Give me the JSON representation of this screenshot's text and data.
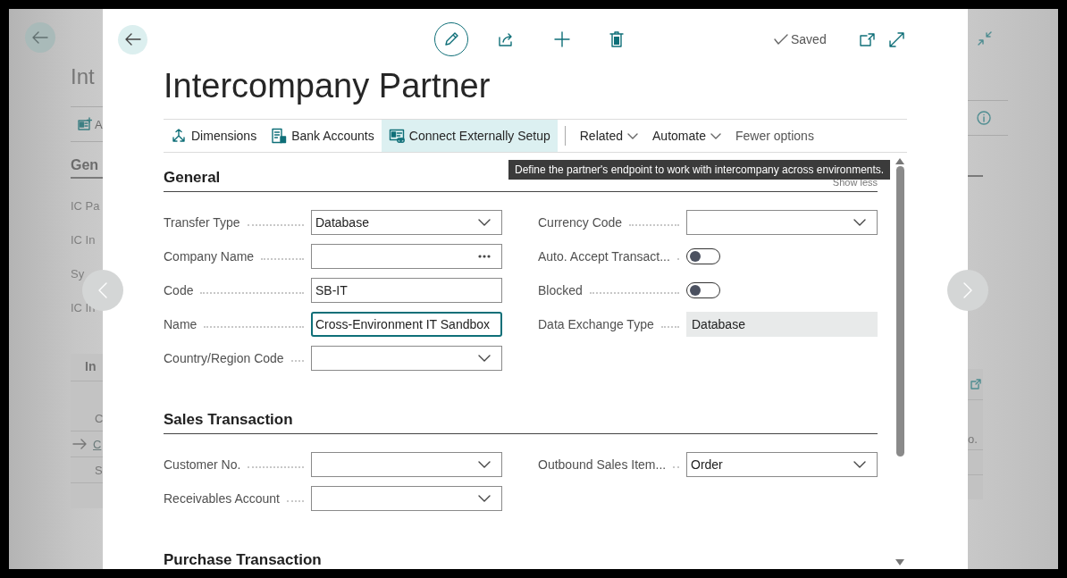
{
  "background_page": {
    "title": "Int",
    "action": "A",
    "section": "Gen",
    "fields": [
      "IC Pa",
      "IC In",
      "Sy",
      "IC In"
    ],
    "part_title": "In",
    "rows": [
      "C",
      "C",
      "S"
    ],
    "right_text": "o."
  },
  "dialog": {
    "saved": "Saved",
    "title": "Intercompany Partner",
    "actions": [
      {
        "label": "Dimensions",
        "kind": "action",
        "hovered": false
      },
      {
        "label": "Bank Accounts",
        "kind": "action",
        "hovered": false
      },
      {
        "label": "Connect Externally Setup",
        "kind": "action",
        "hovered": true
      },
      {
        "label": "Related",
        "kind": "menu",
        "hovered": false
      },
      {
        "label": "Automate",
        "kind": "menu",
        "hovered": false
      },
      {
        "label": "Fewer options",
        "kind": "link",
        "hovered": false
      }
    ],
    "tooltip": "Define the partner's endpoint to work with intercompany across environments.",
    "sections": [
      {
        "title": "General",
        "toggle": "Show less",
        "columns": [
          [
            {
              "label": "Transfer Type",
              "kind": "dropdown",
              "value": "Database",
              "focused": false
            },
            {
              "label": "Company Name",
              "kind": "lookup",
              "focused": false
            },
            {
              "label": "Code",
              "kind": "text",
              "value": "SB-IT",
              "focused": false
            },
            {
              "label": "Name",
              "kind": "text",
              "value": "Cross-Environment IT Sandbox",
              "focused": true
            },
            {
              "label": "Country/Region Code",
              "kind": "dropdown",
              "focused": false
            }
          ],
          [
            {
              "label": "Currency Code",
              "kind": "dropdown",
              "focused": false
            },
            {
              "label": "Auto. Accept Transact...",
              "kind": "toggle",
              "on": false
            },
            {
              "label": "Blocked",
              "kind": "toggle",
              "on": false
            },
            {
              "label": "Data Exchange Type",
              "kind": "readonly",
              "value": "Database"
            }
          ]
        ]
      },
      {
        "title": "Sales Transaction",
        "columns": [
          [
            {
              "label": "Customer No.",
              "kind": "dropdown",
              "focused": false
            },
            {
              "label": "Receivables Account",
              "kind": "dropdown",
              "focused": false
            }
          ],
          [
            {
              "label": "Outbound Sales Item...",
              "kind": "dropdown",
              "value": "Order",
              "focused": false
            }
          ]
        ]
      },
      {
        "title": "Purchase Transaction"
      }
    ]
  }
}
